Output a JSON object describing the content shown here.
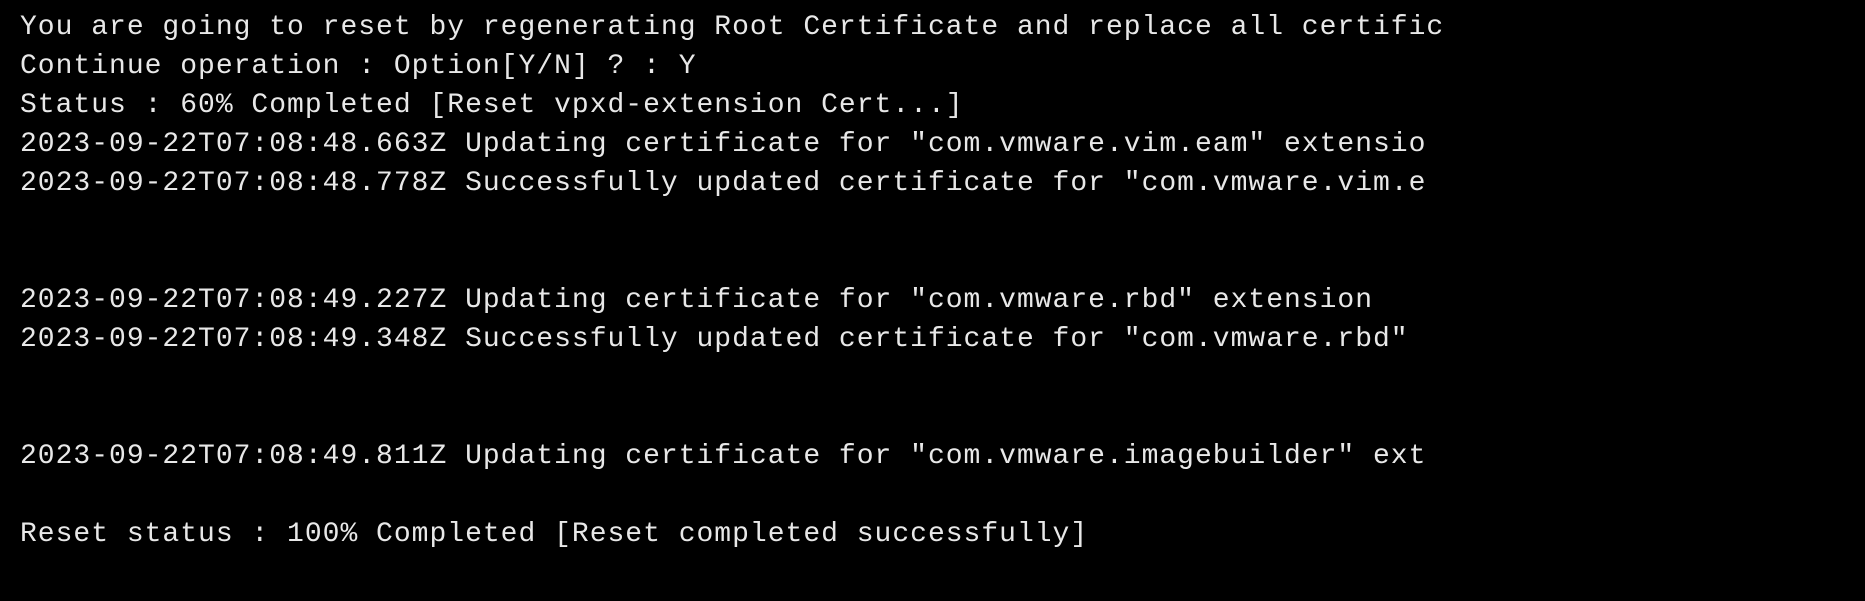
{
  "terminal": {
    "lines": [
      "You are going to reset by regenerating Root Certificate and replace all certific",
      "Continue operation : Option[Y/N] ? : Y",
      "Status : 60% Completed [Reset vpxd-extension Cert...]",
      "2023-09-22T07:08:48.663Z  Updating certificate for \"com.vmware.vim.eam\" extensio",
      "2023-09-22T07:08:48.778Z  Successfully updated certificate for \"com.vmware.vim.e",
      "",
      "",
      "2023-09-22T07:08:49.227Z  Updating certificate for \"com.vmware.rbd\" extension",
      "2023-09-22T07:08:49.348Z  Successfully updated certificate for \"com.vmware.rbd\"",
      "",
      "",
      "2023-09-22T07:08:49.811Z  Updating certificate for \"com.vmware.imagebuilder\" ext",
      "",
      "Reset status : 100% Completed [Reset completed successfully]"
    ]
  }
}
